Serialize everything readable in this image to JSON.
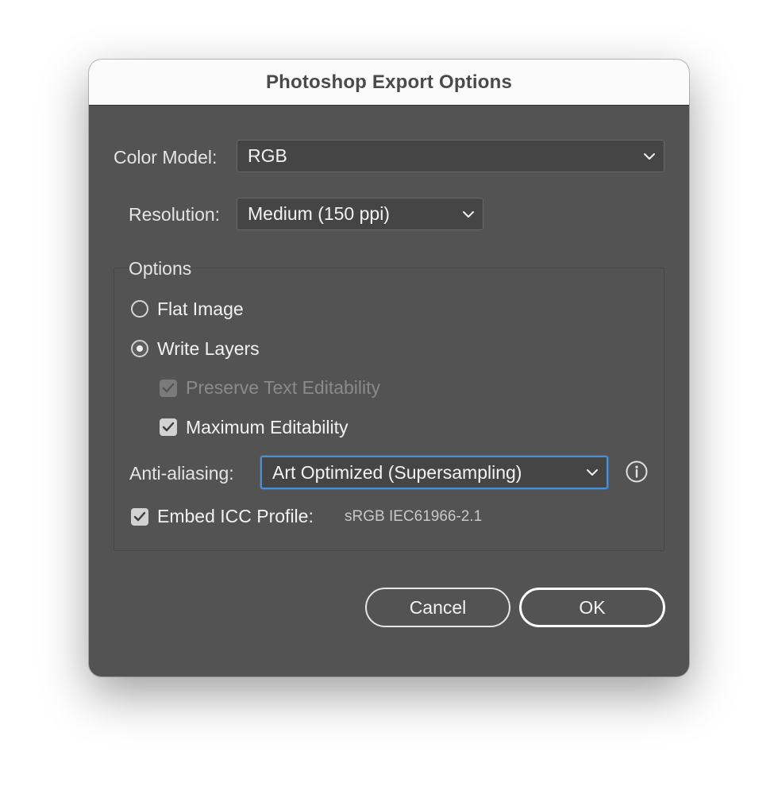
{
  "dialog": {
    "title": "Photoshop Export Options"
  },
  "color_model": {
    "label": "Color Model:",
    "value": "RGB"
  },
  "resolution": {
    "label": "Resolution:",
    "value": "Medium (150 ppi)"
  },
  "options": {
    "group_title": "Options",
    "flat_image": {
      "label": "Flat Image",
      "selected": false
    },
    "write_layers": {
      "label": "Write Layers",
      "selected": true
    },
    "preserve_text": {
      "label": "Preserve Text Editability",
      "checked": true,
      "enabled": false
    },
    "max_editability": {
      "label": "Maximum Editability",
      "checked": true,
      "enabled": true
    },
    "anti_aliasing": {
      "label": "Anti-aliasing:",
      "value": "Art Optimized (Supersampling)",
      "info_icon": "info-circle-icon"
    },
    "embed_icc": {
      "label": "Embed ICC Profile:",
      "checked": true,
      "profile": "sRGB IEC61966-2.1"
    }
  },
  "buttons": {
    "cancel": "Cancel",
    "ok": "OK"
  },
  "colors": {
    "dialog_bg": "#535353",
    "titlebar_bg": "#fbfbfb",
    "focus_ring": "#4a90d9"
  }
}
